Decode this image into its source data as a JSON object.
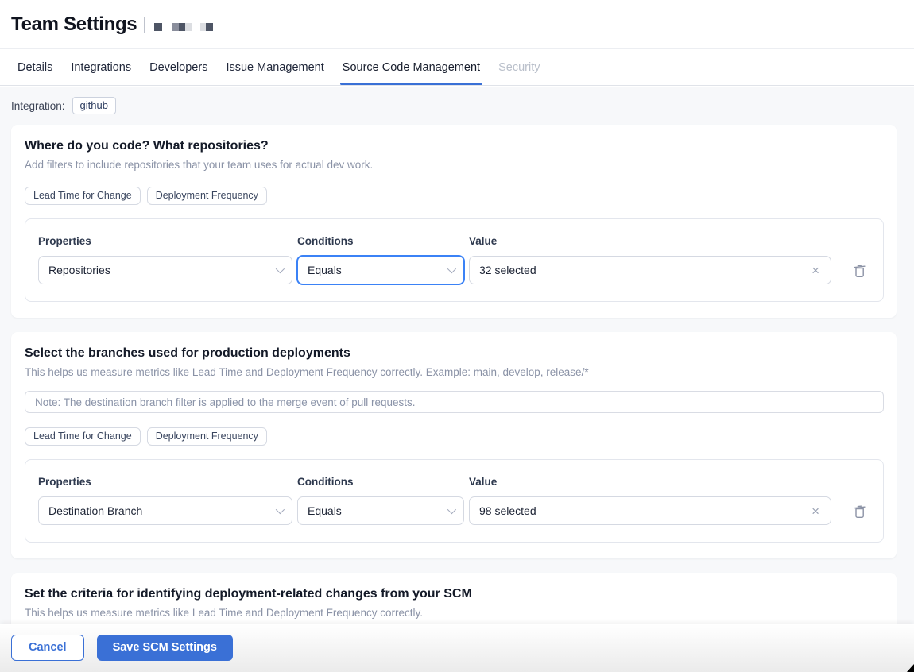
{
  "header": {
    "title": "Team Settings"
  },
  "tabs": {
    "items": [
      {
        "label": "Details"
      },
      {
        "label": "Integrations"
      },
      {
        "label": "Developers"
      },
      {
        "label": "Issue Management"
      },
      {
        "label": "Source Code Management"
      },
      {
        "label": "Security"
      }
    ],
    "active": "Source Code Management",
    "disabled": "Security"
  },
  "integration": {
    "label": "Integration:",
    "value": "github"
  },
  "cards": [
    {
      "title": "Where do you code? What repositories?",
      "subtitle": "Add filters to include repositories that your team uses for actual dev work.",
      "badges": [
        "Lead Time for Change",
        "Deployment Frequency"
      ],
      "filter": {
        "properties_label": "Properties",
        "conditions_label": "Conditions",
        "value_label": "Value",
        "property": "Repositories",
        "condition": "Equals",
        "value": "32 selected"
      }
    },
    {
      "title": "Select the branches used for production deployments",
      "subtitle": "This helps us measure metrics like Lead Time and Deployment Frequency correctly. Example: main, develop, release/*",
      "note_placeholder": "Note: The destination branch filter is applied to the merge event of pull requests.",
      "badges": [
        "Lead Time for Change",
        "Deployment Frequency"
      ],
      "filter": {
        "properties_label": "Properties",
        "conditions_label": "Conditions",
        "value_label": "Value",
        "property": "Destination Branch",
        "condition": "Equals",
        "value": "98 selected"
      }
    },
    {
      "title": "Set the criteria for identifying deployment-related changes from your SCM",
      "subtitle": "This helps us measure metrics like Lead Time and Deployment Frequency correctly."
    }
  ],
  "icons": {
    "clear": "×"
  },
  "footer": {
    "cancel_label": "Cancel",
    "save_label": "Save SCM Settings"
  },
  "colors": {
    "accent_blue": "#3a70d6",
    "focus_blue": "#3b82f6",
    "page_background": "#f7f8fa",
    "disabled_tab": "#b9bfca"
  }
}
